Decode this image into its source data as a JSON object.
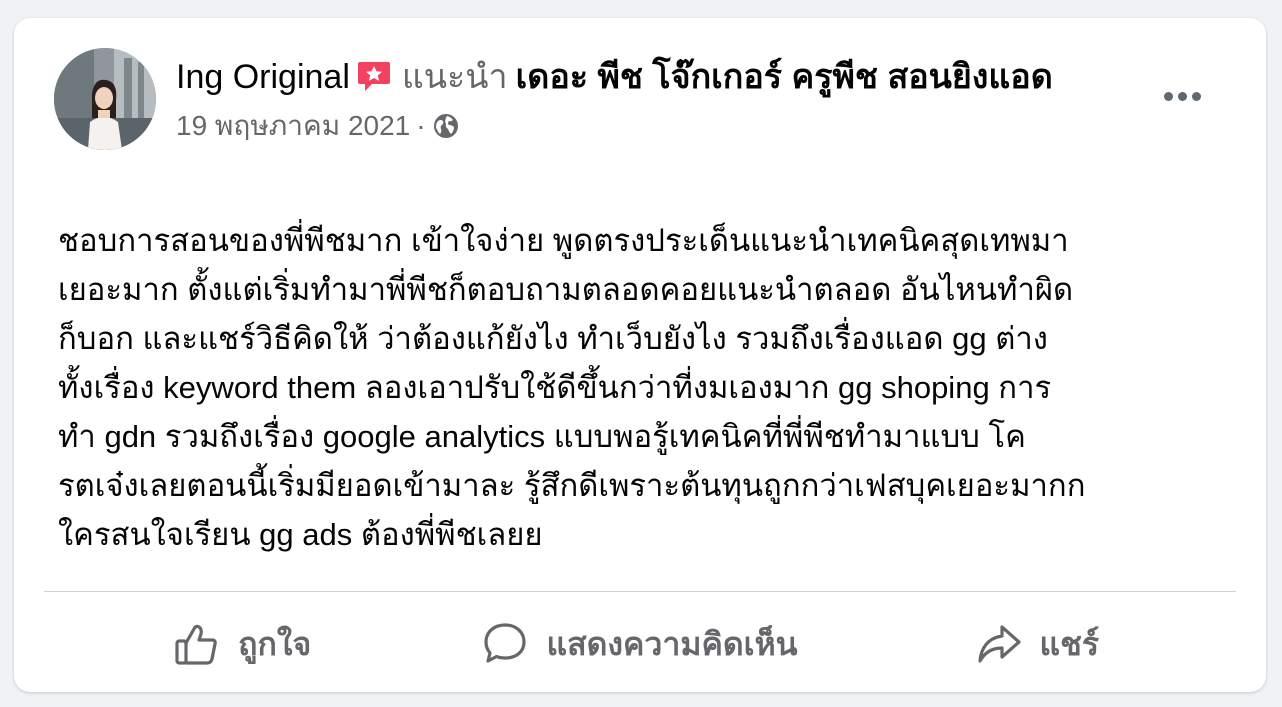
{
  "post": {
    "author": "Ing Original",
    "recommends_label": "แนะนำ",
    "page_name": "เดอะ พีช โจ๊กเกอร์ ครูพีช สอนยิงแอด",
    "date": "19 พฤษภาคม 2021",
    "separator": "·",
    "body": "ชอบการสอนของพี่พีชมาก เข้าใจง่าย พูดตรงประเด็นแนะนำเทคนิคสุดเทพมา\nเยอะมาก ตั้งแต่เริ่มทำมาพี่พีชก็ตอบถามตลอดคอยแนะนำตลอด อันไหนทำผิด\nก็บอก และแชร์วิธีคิดให้  ว่าต้องแก้ยังไง ทำเว็บยังไง รวมถึงเรื่องแอด gg ต่าง\nทั้งเรื่อง keyword them ลองเอาปรับใช้ดีขึ้นกว่าที่งมเองมาก gg shoping การ\nทำ gdn รวมถึงเรื่อง google analytics แบบพอรู้เทคนิคที่พี่พีชทำมาแบบ โค\nรตเจ๋งเลยตอนนี้เริ่มมียอดเข้ามาละ รู้สึกดีเพราะต้นทุนถูกกว่าเฟสบุคเยอะมากก\nใครสนใจเรียน gg ads ต้องพี่พีชเลยย"
  },
  "icons": {
    "badge": "recommend-badge-icon",
    "audience": "globe-icon",
    "more": "more-options-icon",
    "like": "thumbs-up-icon",
    "comment": "comment-bubble-icon",
    "share": "share-arrow-icon"
  },
  "actions": {
    "like_label": "ถูกใจ",
    "comment_label": "แสดงความคิดเห็น",
    "share_label": "แชร์"
  },
  "colors": {
    "badge": "#f3425f",
    "secondary_text": "#65676b",
    "primary_text": "#050505",
    "divider": "#ced0d4"
  }
}
